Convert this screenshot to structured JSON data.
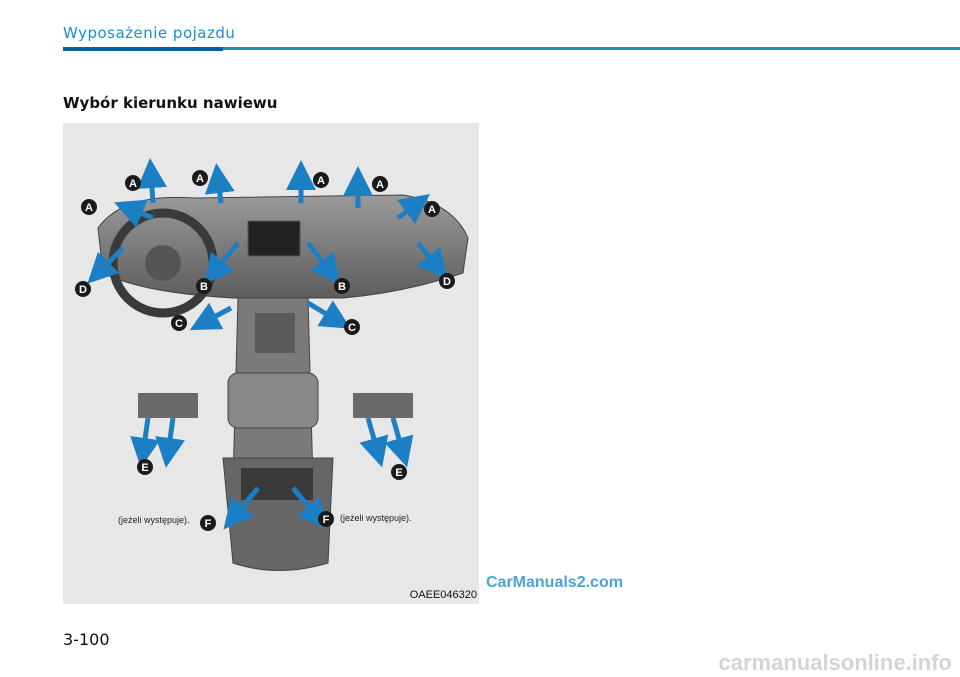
{
  "header": {
    "section_title": "Wyposażenie pojazdu"
  },
  "subheading": "Wybór kierunku nawiewu",
  "figure": {
    "code": "OAEE046320",
    "note_left": "(jeżeli występuje).",
    "note_right": "(jeżeli występuje).",
    "labels": {
      "A": "A",
      "B": "B",
      "C": "C",
      "D": "D",
      "E": "E",
      "F": "F"
    }
  },
  "watermark": "CarManuals2.com",
  "page_number": "3-100",
  "footer_watermark": "carmanualsonline.info",
  "colors": {
    "accent": "#1a8fd0",
    "arrow": "#1c7fc4"
  }
}
